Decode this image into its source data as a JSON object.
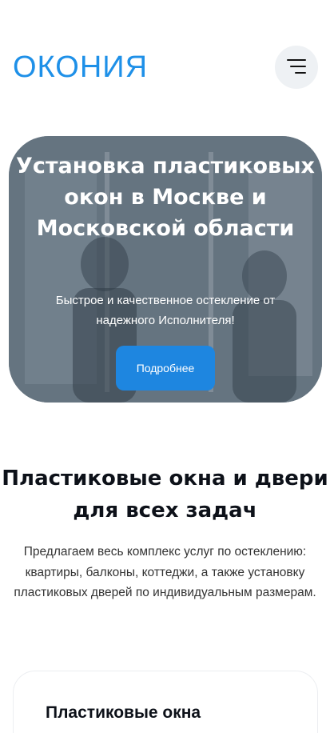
{
  "header": {
    "logo": "ОКОНИЯ",
    "menu_icon": "hamburger-menu-icon"
  },
  "hero": {
    "title": "Установка пластиковых окон в Москве и Московской области",
    "subtitle": "Быстрое и качественное остекление от надежного Исполнителя!",
    "button_label": "Подробнее",
    "button_color": "#1e86e0"
  },
  "section": {
    "title": "Пластиковые окна и двери для всех задач",
    "text": "Предлагаем весь комплекс услуг по остеклению: квартиры, балконы, коттеджи, а также установку пластиковых дверей по индивидуальным размерам."
  },
  "card": {
    "title": "Пластиковые окна"
  },
  "colors": {
    "accent": "#1e90e8",
    "text": "#0d1119"
  }
}
